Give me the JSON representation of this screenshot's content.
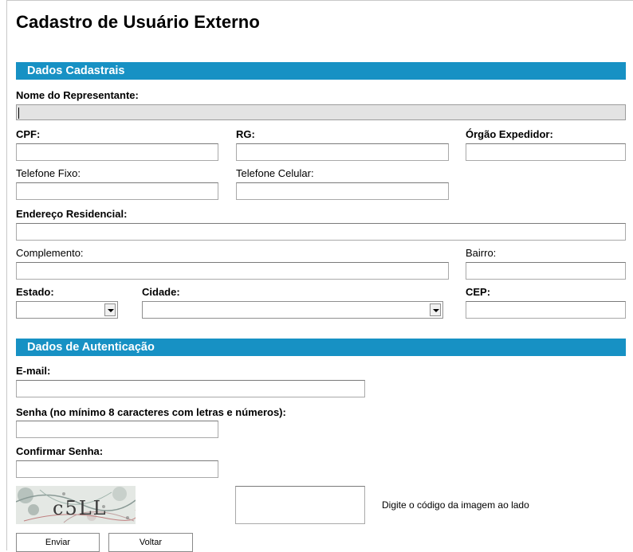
{
  "page": {
    "title": "Cadastro de Usuário Externo"
  },
  "sections": {
    "personal": "Dados Cadastrais",
    "auth": "Dados de Autenticação"
  },
  "fields": {
    "nome_label": "Nome do Representante:",
    "cpf_label": "CPF:",
    "rg_label": "RG:",
    "orgao_label": "Órgão Expedidor:",
    "telefone_fixo_label": "Telefone Fixo:",
    "telefone_celular_label": "Telefone Celular:",
    "endereco_label": "Endereço Residencial:",
    "complemento_label": "Complemento:",
    "bairro_label": "Bairro:",
    "estado_label": "Estado:",
    "cidade_label": "Cidade:",
    "cep_label": "CEP:",
    "email_label": "E-mail:",
    "senha_label": "Senha (no mínimo 8 caracteres com letras e números):",
    "confirmar_senha_label": "Confirmar Senha:"
  },
  "captcha": {
    "image_text": "c5LL",
    "instruction": "Digite o código da imagem ao lado"
  },
  "buttons": {
    "enviar": "Enviar",
    "voltar": "Voltar"
  }
}
